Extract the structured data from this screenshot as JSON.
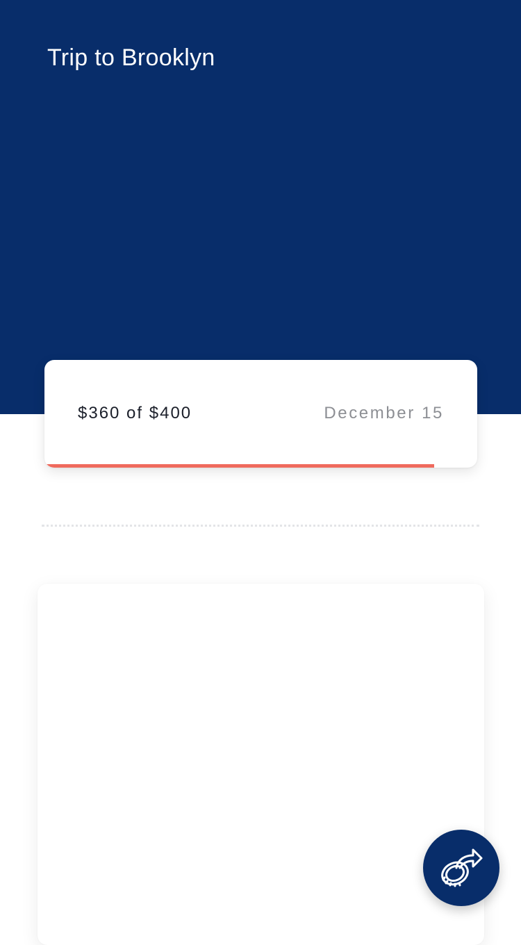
{
  "goal": {
    "title": "Trip to Brooklyn"
  },
  "progress": {
    "amount_label": "$360 of $400",
    "due_date": "December 15",
    "saved": 360,
    "target": 400,
    "fraction": 0.9
  },
  "colors": {
    "primary": "#082d6a",
    "accent": "#ef6a5d",
    "muted_text": "#8d8f94"
  },
  "fab": {
    "icon": "coin-share-icon"
  }
}
